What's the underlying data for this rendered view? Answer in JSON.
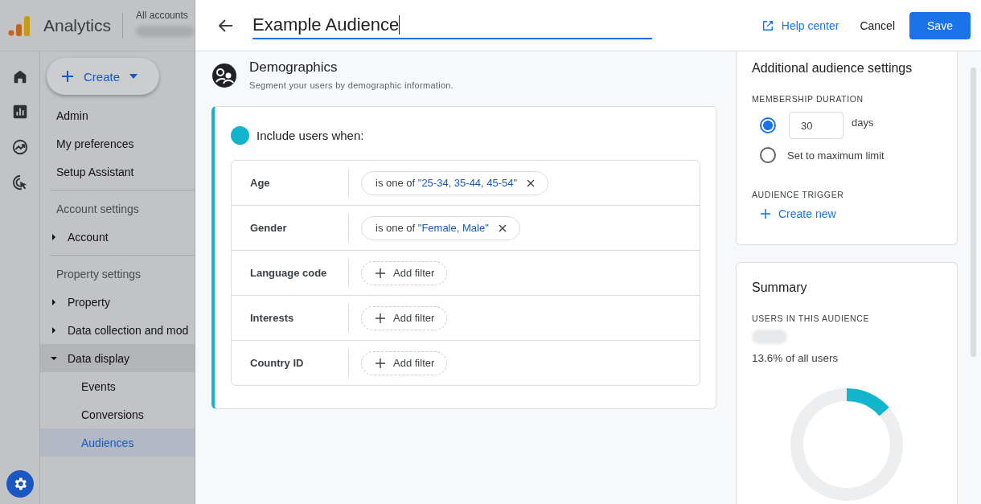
{
  "app": {
    "product": "Analytics",
    "account_label": "All accounts",
    "create_button": "Create"
  },
  "rail": [
    {
      "kind": "home"
    },
    {
      "kind": "reports"
    },
    {
      "kind": "explore"
    },
    {
      "kind": "advertising"
    }
  ],
  "nav": [
    {
      "kind": "link",
      "label": "Admin"
    },
    {
      "kind": "link",
      "label": "My preferences"
    },
    {
      "kind": "link",
      "label": "Setup Assistant"
    },
    {
      "kind": "divider"
    },
    {
      "kind": "header",
      "label": "Account settings"
    },
    {
      "kind": "group",
      "label": "Account",
      "expanded": false
    },
    {
      "kind": "divider"
    },
    {
      "kind": "header",
      "label": "Property settings"
    },
    {
      "kind": "group",
      "label": "Property",
      "expanded": false
    },
    {
      "kind": "group",
      "label": "Data collection and mod",
      "expanded": false
    },
    {
      "kind": "group",
      "label": "Data display",
      "expanded": true,
      "children": [
        {
          "label": "Events",
          "selected": false
        },
        {
          "label": "Conversions",
          "selected": false
        },
        {
          "label": "Audiences",
          "selected": true
        }
      ]
    }
  ],
  "editor": {
    "title": "Example Audience",
    "help": "Help center",
    "cancel": "Cancel",
    "save": "Save"
  },
  "section": {
    "title": "Demographics",
    "subtitle": "Segment your users by demographic information.",
    "include_label": "Include users when:",
    "filters": [
      {
        "label": "Age",
        "kind": "condition",
        "operator": "is one of",
        "value": "\"25-34, 35-44, 45-54\""
      },
      {
        "label": "Gender",
        "kind": "condition",
        "operator": "is one of",
        "value": "\"Female, Male\""
      },
      {
        "label": "Language code",
        "kind": "add",
        "action": "Add filter"
      },
      {
        "label": "Interests",
        "kind": "add",
        "action": "Add filter"
      },
      {
        "label": "Country ID",
        "kind": "add",
        "action": "Add filter"
      }
    ]
  },
  "settings": {
    "title": "Additional audience settings",
    "duration_label": "MEMBERSHIP DURATION",
    "options": [
      {
        "kind": "days",
        "value": "30",
        "unit": "days",
        "selected": true
      },
      {
        "kind": "max",
        "label": "Set to maximum limit",
        "selected": false
      }
    ],
    "trigger_label": "AUDIENCE TRIGGER",
    "trigger_action": "Create new"
  },
  "summary": {
    "title": "Summary",
    "users_label": "USERS IN THIS AUDIENCE",
    "share": "13.6% of all users",
    "chart_data": {
      "type": "donut",
      "values": [
        13.6,
        86.4
      ]
    }
  }
}
